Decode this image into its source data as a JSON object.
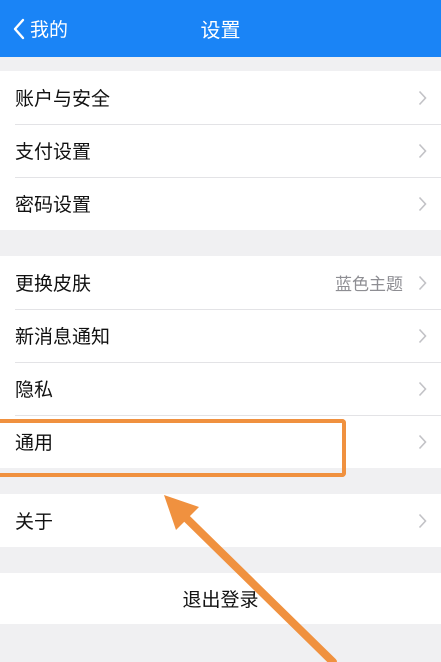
{
  "nav": {
    "back_label": "我的",
    "title": "设置"
  },
  "groups": {
    "security": {
      "account": "账户与安全",
      "payment": "支付设置",
      "password": "密码设置"
    },
    "personal": {
      "skin": "更换皮肤",
      "skin_value": "蓝色主题",
      "notifications": "新消息通知",
      "privacy": "隐私",
      "general": "通用"
    },
    "about": {
      "about": "关于"
    }
  },
  "logout_label": "退出登录",
  "colors": {
    "nav_bg": "#1a84f6",
    "annotation": "#f0913f",
    "page_bg": "#f0f0f2"
  }
}
